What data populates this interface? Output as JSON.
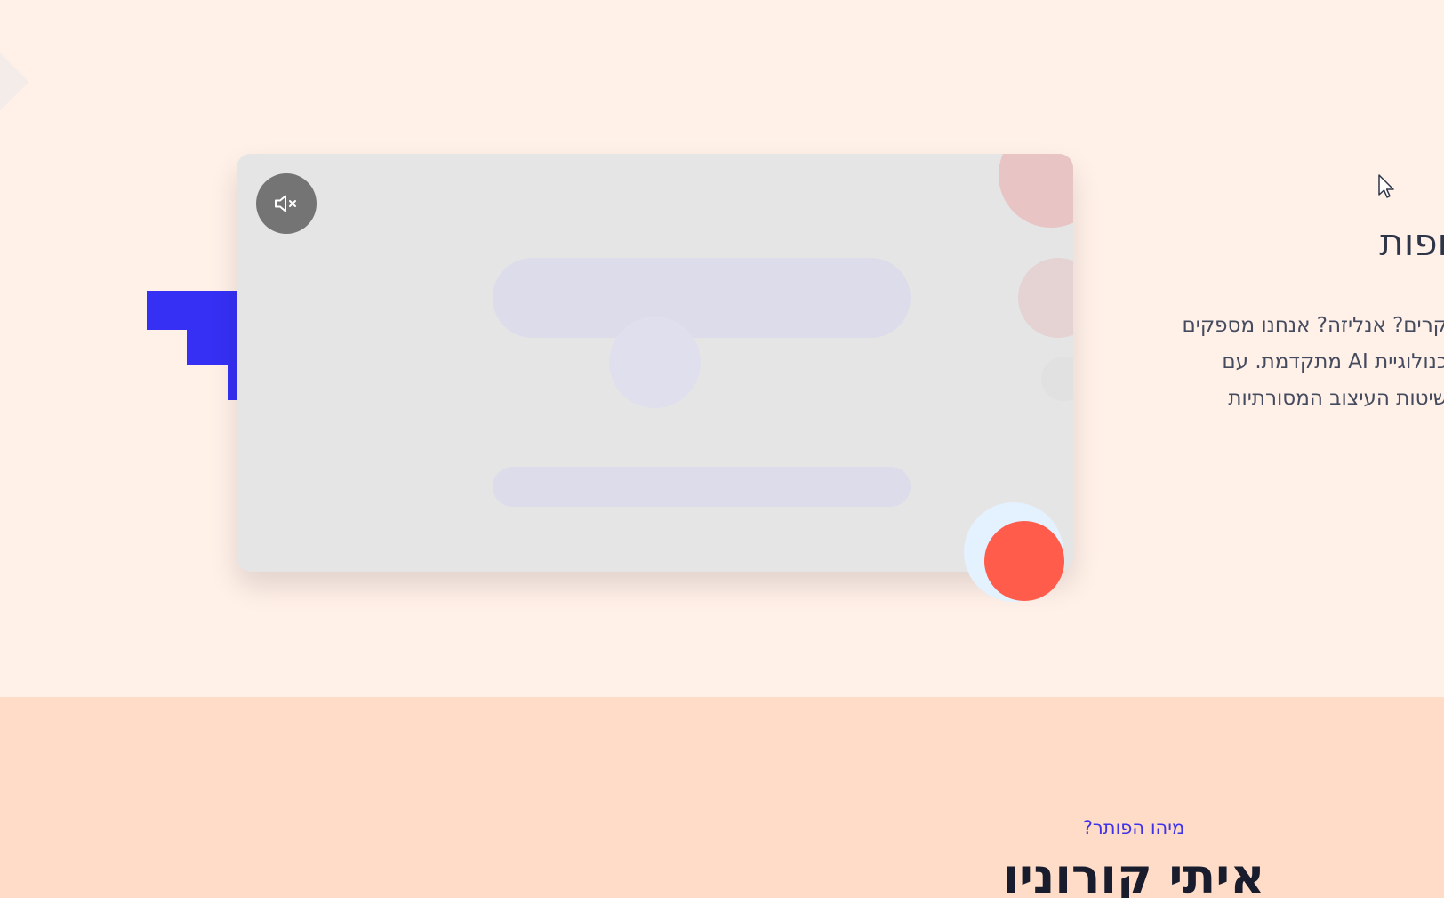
{
  "hero": {
    "title": "ופות",
    "text_lines": [
      "קרים? אנליזה? אנחנו מספקים",
      "כנולוגיית AI מתקדמת. עם",
      "שיטות העיצוב המסורתיות"
    ],
    "video": {
      "mute_icon": "volume-mute-icon"
    }
  },
  "about": {
    "label": "מיהו הפותר?",
    "name": "איתי קורוניו"
  },
  "colors": {
    "background": "#fff0e8",
    "about_background": "#ffdcc7",
    "accent_blue": "#3630f5",
    "record_red": "#ff5c4b",
    "label_blue": "#3e33e8"
  }
}
